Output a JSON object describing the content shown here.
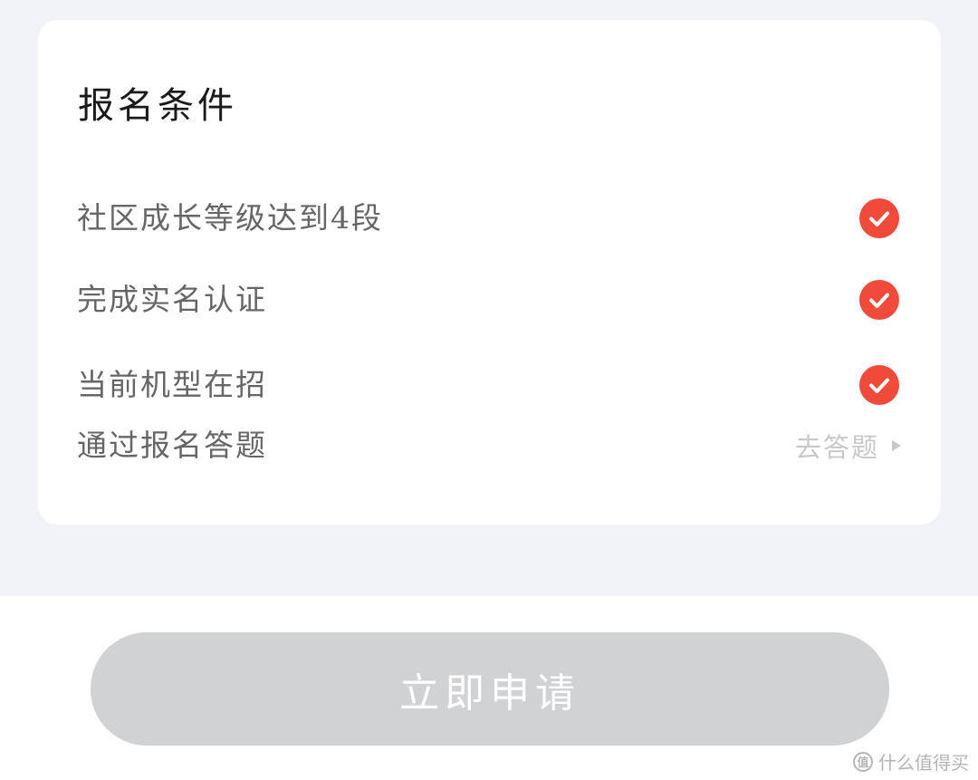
{
  "card": {
    "title": "报名条件",
    "conditions": [
      {
        "label": "社区成长等级达到4段",
        "status": "done",
        "icon": "check-circle-icon"
      },
      {
        "label": "完成实名认证",
        "status": "done",
        "icon": "check-circle-icon"
      },
      {
        "label": "当前机型在招",
        "status": "done",
        "icon": "check-circle-icon"
      },
      {
        "label": "通过报名答题",
        "status": "pending",
        "action_label": "去答题",
        "icon": "triangle-right-icon"
      }
    ]
  },
  "apply_button": {
    "label": "立即申请",
    "state": "disabled"
  },
  "watermark": {
    "text": "什么值得买",
    "logo_glyph": "值"
  },
  "colors": {
    "page_bg": "#f2f3f7",
    "card_bg": "#ffffff",
    "check_red": "#f04a3a",
    "button_disabled": "#d1d2d4",
    "muted_text": "#c8c8c8"
  }
}
